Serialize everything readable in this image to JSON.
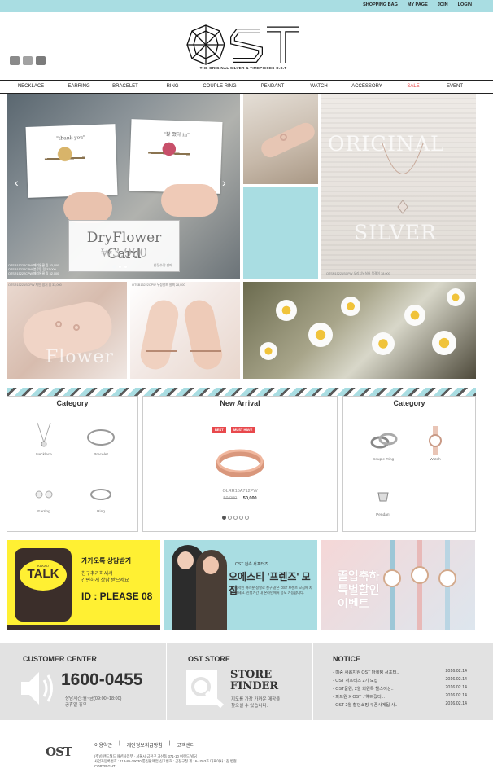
{
  "top_links": [
    "SHOPPING BAG",
    "MY PAGE",
    "JOIN",
    "LOGIN"
  ],
  "logo": {
    "text": "OST",
    "tagline": "THE ORIGINAL SILVER & TIMEPIECES O.S.T"
  },
  "social_icons": [
    "instagram-icon",
    "blog-icon",
    "facebook-icon"
  ],
  "nav": {
    "items": [
      {
        "label": "NECKLACE",
        "sale": false
      },
      {
        "label": "EARRING",
        "sale": false
      },
      {
        "label": "BRACELET",
        "sale": false
      },
      {
        "label": "RING",
        "sale": false
      },
      {
        "label": "COUPLE RING",
        "sale": false
      },
      {
        "label": "PENDANT",
        "sale": false
      },
      {
        "label": "WATCH",
        "sale": false
      },
      {
        "label": "ACCESSORY",
        "sale": false
      },
      {
        "label": "SALE",
        "sale": true
      },
      {
        "label": "EVENT",
        "sale": false
      }
    ]
  },
  "hero": {
    "card1_text": "\"thank you\"",
    "card2_text": "\"잘 했다 in\"",
    "df_title": "DryFlower Card",
    "df_price": "₩3,900",
    "df_note": "한정수량 판매",
    "captions": [
      "OTSR15222CPW 페리윈클 링 33,000",
      "OTSR15222CPW 블루밍 링 32,000",
      "OTSR15222CPW 페리윈클 링 32,000"
    ],
    "cap_ring": "OTSR15221SCPW 체인 핑거 링 33,000",
    "cap_silver": "OTSN15221SCPW 오리지널실버 목걸이 38,000",
    "cap_bracelet": "OTSB15222CPW 우정팔찌 팔찌 28,000",
    "original": "ORIGINAL",
    "silver": "SILVER",
    "flower": "Flower"
  },
  "panels": {
    "left": {
      "title": "Category",
      "items": [
        "Necklace",
        "Bracelet",
        "Earring",
        "Ring"
      ]
    },
    "center": {
      "title": "New Arrival",
      "badges": [
        "BEST",
        "MUST HAVE"
      ],
      "code": "OLRR15A712PW",
      "old_price": "59,000",
      "price": "50,000"
    },
    "right": {
      "title": "Category",
      "items": [
        "Couple Ring",
        "Watch",
        "Pendant"
      ]
    }
  },
  "banners": {
    "kakao": {
      "pre": "KAKAO",
      "big": "TALK",
      "title": "카카오톡 상담받기",
      "line1": "친구추가하셔서",
      "line2": "간편하게 상담 받으세요",
      "id": "ID : PLEASE 08"
    },
    "friends": {
      "title": "OST 전속 서포터즈",
      "headline": "오에스티 '프렌즈' 모집",
      "desc": "성공적인 여러분 정말로 친구 같은 OST 프렌즈 모집에 지원하세요. 신청기간 내 온라인에서 응모 가능합니다."
    },
    "event": {
      "line1": "졸업축하",
      "line2": "특별할인",
      "line3": "이벤트"
    }
  },
  "footer": {
    "customer": {
      "heading": "CUSTOMER CENTER",
      "phone": "1600-0455",
      "hours": "상담시간:월~금(09:00~18:00)",
      "holiday": "공휴일 휴무"
    },
    "store": {
      "heading": "OST STORE",
      "title1": "STORE",
      "title2": "FINDER",
      "desc1": "지도를 가장 가까운 매장을",
      "desc2": "찾으실 수 있습니다."
    },
    "notice": {
      "heading": "NOTICE",
      "rows": [
        {
          "title": "- 미중 새롭지원 OST 마케팅 서포터..",
          "date": "2016.02.14"
        },
        {
          "title": "- OST 서포터즈 2기 모집",
          "date": "2016.02.14"
        },
        {
          "title": "- OST물원, 2월 회원특 헬스이상..",
          "date": "2016.02.14"
        },
        {
          "title": "- 파트원 X OST : '예뻐졌다'..",
          "date": "2016.02.14"
        },
        {
          "title": "- OST 2월 할인쇼핑 쿠폰사게됩 사..",
          "date": "2016.02.14"
        }
      ]
    },
    "links": [
      "이용약관",
      "|",
      "개인정보취급방침",
      "|",
      "고객센터"
    ],
    "company": [
      "(주)이랜드월드 패션사업부 · 서울시 금천구 가산동 371-10 이랜드 빌딩",
      "사업자등록번호 : 113-85-19030 통신판매업 신고번호 : 금천구청 제 16-1053호 대표이사 : 김 병철",
      "COPYRIGHT"
    ],
    "logo_text": "OST"
  },
  "colors": {
    "accent": "#a9dde2",
    "sale": "#e53a3a",
    "kakao": "#fff033",
    "footer_bg": "#e2e2e2"
  }
}
